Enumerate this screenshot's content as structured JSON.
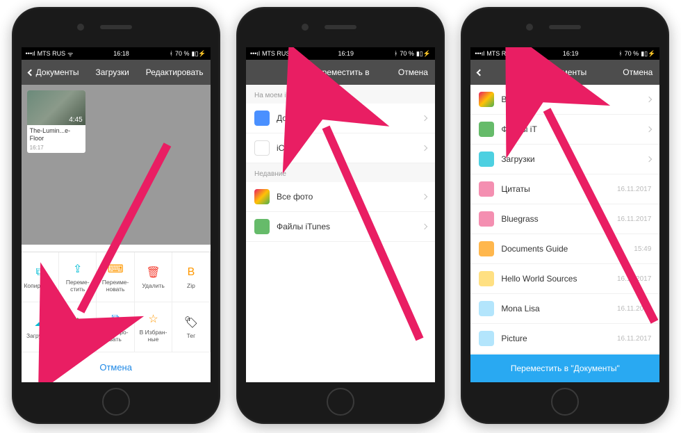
{
  "status": {
    "carrier": "MTS RUS",
    "wifi": "⋮⋮⋮",
    "time1": "16:18",
    "time2": "16:19",
    "time3": "16:19",
    "bt": "⚡",
    "battery_pct": "70 %",
    "battery_icon": "▮▯"
  },
  "phone1": {
    "nav": {
      "back": "Документы",
      "title": "Загрузки",
      "right": "Редактировать"
    },
    "thumb": {
      "duration": "4:45",
      "name": "The-Lumin...e-Floor",
      "time": "16:17"
    },
    "actions": {
      "row1": [
        {
          "icon": "⧉",
          "color": "i-cyan",
          "label": "Копировать",
          "name": "copy"
        },
        {
          "icon": "⇪",
          "color": "i-cyan",
          "label": "Переме-стить",
          "name": "move"
        },
        {
          "icon": "⌨",
          "color": "i-orange",
          "label": "Переиме-новать",
          "name": "rename"
        },
        {
          "icon": "🗑",
          "color": "i-red",
          "label": "Удалить",
          "name": "delete"
        },
        {
          "icon": "B",
          "color": "i-orange",
          "label": "Zip",
          "name": "zip"
        }
      ],
      "row2": [
        {
          "icon": "☁",
          "color": "i-cyan",
          "label": "Загрузить",
          "name": "upload"
        },
        {
          "icon": "⬆",
          "color": "i-green",
          "label": "Поделиться",
          "name": "share"
        },
        {
          "icon": "⧉",
          "color": "i-blue",
          "label": "Дублиро-вать",
          "name": "duplicate"
        },
        {
          "icon": "☆",
          "color": "i-orange",
          "label": "В Избран-ные",
          "name": "favorite"
        },
        {
          "icon": "🏷",
          "color": "",
          "label": "Тег",
          "name": "tag"
        }
      ]
    },
    "cancel": "Отмена"
  },
  "phone2": {
    "nav": {
      "title": "Переместить в",
      "right": "Отмена"
    },
    "section1": "На моем iPhone",
    "section2": "Недавние",
    "rows1": [
      {
        "icon_class": "folder-blue",
        "label": "Документы",
        "name": "documents"
      },
      {
        "icon_class": "folder-white",
        "label": "iCloud",
        "name": "icloud"
      }
    ],
    "rows2": [
      {
        "icon_class": "folder-multi",
        "label": "Все фото",
        "name": "all-photos"
      },
      {
        "icon_class": "folder-green",
        "label": "Файлы iTunes",
        "name": "itunes-files"
      }
    ]
  },
  "phone3": {
    "nav": {
      "title": "Документы",
      "right": "Отмена"
    },
    "rows": [
      {
        "icon_class": "folder-multi",
        "label": "Все фото",
        "date": "",
        "chev": true,
        "name": "all-photos"
      },
      {
        "icon_class": "folder-green",
        "label": "Файлы iT",
        "date": "",
        "chev": true,
        "name": "itunes-files"
      },
      {
        "icon_class": "folder-cyan",
        "label": "Загрузки",
        "date": "",
        "chev": true,
        "name": "downloads"
      },
      {
        "icon_class": "folder-pink",
        "label": "Цитаты",
        "date": "16.11.2017",
        "chev": false,
        "name": "quotes"
      },
      {
        "icon_class": "folder-pink",
        "label": "Bluegrass",
        "date": "16.11.2017",
        "chev": false,
        "name": "bluegrass"
      },
      {
        "icon_class": "folder-orange",
        "label": "Documents Guide",
        "date": "15:49",
        "chev": false,
        "name": "documents-guide"
      },
      {
        "icon_class": "folder-yellow",
        "label": "Hello World Sources",
        "date": "16.11.2017",
        "chev": false,
        "name": "hello-world"
      },
      {
        "icon_class": "folder-lblue",
        "label": "Mona Lisa",
        "date": "16.11.2017",
        "chev": false,
        "name": "mona-lisa"
      },
      {
        "icon_class": "folder-lblue",
        "label": "Picture",
        "date": "16.11.2017",
        "chev": false,
        "name": "picture"
      }
    ],
    "bottom": "Переместить в \"Документы\""
  }
}
